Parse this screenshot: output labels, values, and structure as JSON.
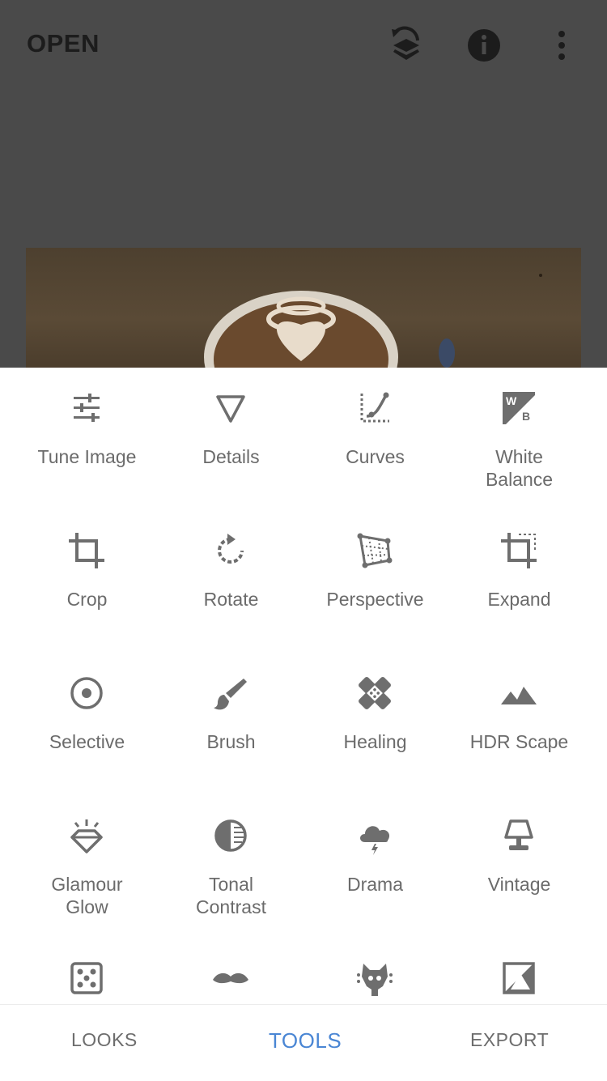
{
  "header": {
    "open_label": "OPEN"
  },
  "tools": [
    {
      "label": "Tune Image",
      "icon": "tune-image-icon"
    },
    {
      "label": "Details",
      "icon": "details-icon"
    },
    {
      "label": "Curves",
      "icon": "curves-icon"
    },
    {
      "label": "White\nBalance",
      "icon": "white-balance-icon"
    },
    {
      "label": "Crop",
      "icon": "crop-icon"
    },
    {
      "label": "Rotate",
      "icon": "rotate-icon"
    },
    {
      "label": "Perspective",
      "icon": "perspective-icon"
    },
    {
      "label": "Expand",
      "icon": "expand-icon"
    },
    {
      "label": "Selective",
      "icon": "selective-icon"
    },
    {
      "label": "Brush",
      "icon": "brush-icon"
    },
    {
      "label": "Healing",
      "icon": "healing-icon"
    },
    {
      "label": "HDR Scape",
      "icon": "hdr-scape-icon"
    },
    {
      "label": "Glamour\nGlow",
      "icon": "glamour-glow-icon"
    },
    {
      "label": "Tonal\nContrast",
      "icon": "tonal-contrast-icon"
    },
    {
      "label": "Drama",
      "icon": "drama-icon"
    },
    {
      "label": "Vintage",
      "icon": "vintage-icon"
    },
    {
      "label": "",
      "icon": "grainy-film-icon"
    },
    {
      "label": "",
      "icon": "retrolux-icon"
    },
    {
      "label": "",
      "icon": "grunge-icon"
    },
    {
      "label": "",
      "icon": "black-white-icon"
    }
  ],
  "bottom_nav": {
    "looks": "LOOKS",
    "tools": "TOOLS",
    "export": "EXPORT"
  },
  "colors": {
    "accent": "#4a86d4",
    "icon": "#6e6e6e",
    "text": "#6b6b6b"
  }
}
